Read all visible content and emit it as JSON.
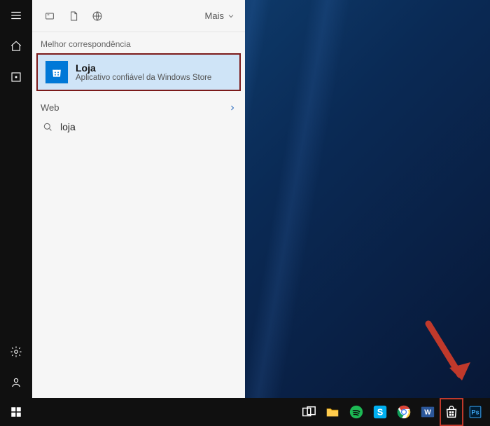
{
  "sidebar": {
    "items": [
      {
        "name": "menu"
      },
      {
        "name": "home"
      },
      {
        "name": "apps"
      }
    ],
    "bottom_items": [
      {
        "name": "settings"
      },
      {
        "name": "account"
      }
    ]
  },
  "panel": {
    "more_label": "Mais",
    "best_match_label": "Melhor correspondência",
    "result": {
      "title": "Loja",
      "subtitle": "Aplicativo confiável da Windows Store"
    },
    "web_label": "Web",
    "web_suggestions": [
      {
        "text": "loja"
      }
    ]
  },
  "search": {
    "value": "loja",
    "placeholder": ""
  },
  "taskbar": {
    "items": [
      {
        "name": "task-view",
        "color": "#ffffff",
        "highlighted": false
      },
      {
        "name": "file-explorer",
        "color": "#ffcc4d",
        "highlighted": false
      },
      {
        "name": "spotify",
        "color": "#1db954",
        "highlighted": false
      },
      {
        "name": "skype",
        "color": "#00aff0",
        "highlighted": false
      },
      {
        "name": "chrome",
        "color": "#ffffff",
        "highlighted": false
      },
      {
        "name": "word",
        "color": "#2b579a",
        "highlighted": false
      },
      {
        "name": "store",
        "color": "#ffffff",
        "highlighted": true
      },
      {
        "name": "photoshop",
        "color": "#3fa9f5",
        "highlighted": false
      }
    ]
  }
}
